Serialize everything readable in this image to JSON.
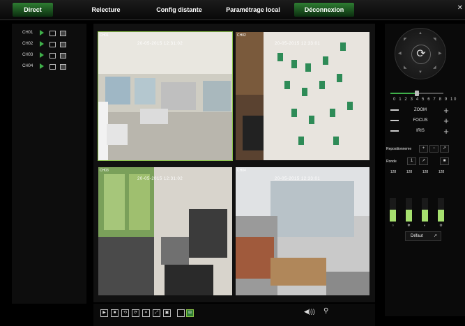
{
  "nav": {
    "tabs": [
      {
        "label": "Direct",
        "active": true
      },
      {
        "label": "Relecture",
        "active": false
      },
      {
        "label": "Config distante",
        "active": false
      },
      {
        "label": "Paramétrage local",
        "active": false
      },
      {
        "label": "Déconnexion",
        "active": true
      }
    ]
  },
  "channels": [
    {
      "label": "CH01"
    },
    {
      "label": "CH02"
    },
    {
      "label": "CH03"
    },
    {
      "label": "CH04"
    }
  ],
  "cameras": [
    {
      "label": "CH01",
      "timestamp": "20-05-2015 12:31:02"
    },
    {
      "label": "CH02",
      "timestamp": "20-05-2015 12:33:01"
    },
    {
      "label": "CH03",
      "timestamp": "20-05-2015 12:31:02"
    },
    {
      "label": "CH04",
      "timestamp": "20-05-2015 12:33:01"
    }
  ],
  "ptz": {
    "speed_scale": "0 1 2 3 4 5 6 7 8 9 10",
    "speed_value": 5,
    "zoom_label": "ZOOM",
    "focus_label": "FOCUS",
    "iris_label": "IRIS",
    "reposition_label": "Repositionneme",
    "ronde_label": "Ronde",
    "ronde_value": "1"
  },
  "image_adjust": {
    "values": [
      "128",
      "128",
      "128",
      "128"
    ],
    "default_label": "Défaut"
  },
  "colors": {
    "accent": "#3fb04a",
    "bar": "#a6e06f"
  }
}
